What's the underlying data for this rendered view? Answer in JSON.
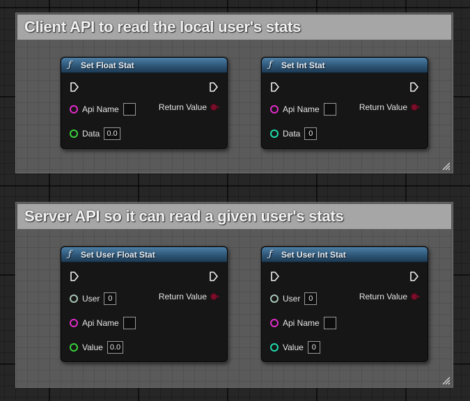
{
  "colors": {
    "string_pin": "#e02bc9",
    "float_pin": "#38d23b",
    "int_pin": "#1fdcab",
    "user_pin": "#a8c7b8",
    "return_pin": "#7a0d2a",
    "node_header": "#2e5677",
    "comment_title_bg": "#a6a6a6"
  },
  "comments": [
    {
      "title": "Client API to read the local user's stats",
      "nodes": [
        {
          "title": "Set Float Stat",
          "icon": "function-icon",
          "pins": [
            {
              "label": "Api Name",
              "type": "string",
              "value": ""
            },
            {
              "label": "Data",
              "type": "float",
              "value": "0.0"
            }
          ],
          "return_label": "Return Value"
        },
        {
          "title": "Set Int Stat",
          "icon": "function-icon",
          "pins": [
            {
              "label": "Api Name",
              "type": "string",
              "value": ""
            },
            {
              "label": "Data",
              "type": "int",
              "value": "0"
            }
          ],
          "return_label": "Return Value"
        }
      ]
    },
    {
      "title": "Server API so it can read a given user's stats",
      "nodes": [
        {
          "title": "Set User Float Stat",
          "icon": "function-icon",
          "pins": [
            {
              "label": "User",
              "type": "user",
              "value": "0"
            },
            {
              "label": "Api Name",
              "type": "string",
              "value": ""
            },
            {
              "label": "Value",
              "type": "float",
              "value": "0.0"
            }
          ],
          "return_label": "Return Value"
        },
        {
          "title": "Set User Int Stat",
          "icon": "function-icon",
          "pins": [
            {
              "label": "User",
              "type": "user",
              "value": "0"
            },
            {
              "label": "Api Name",
              "type": "string",
              "value": ""
            },
            {
              "label": "Value",
              "type": "int",
              "value": "0"
            }
          ],
          "return_label": "Return Value"
        }
      ]
    }
  ]
}
